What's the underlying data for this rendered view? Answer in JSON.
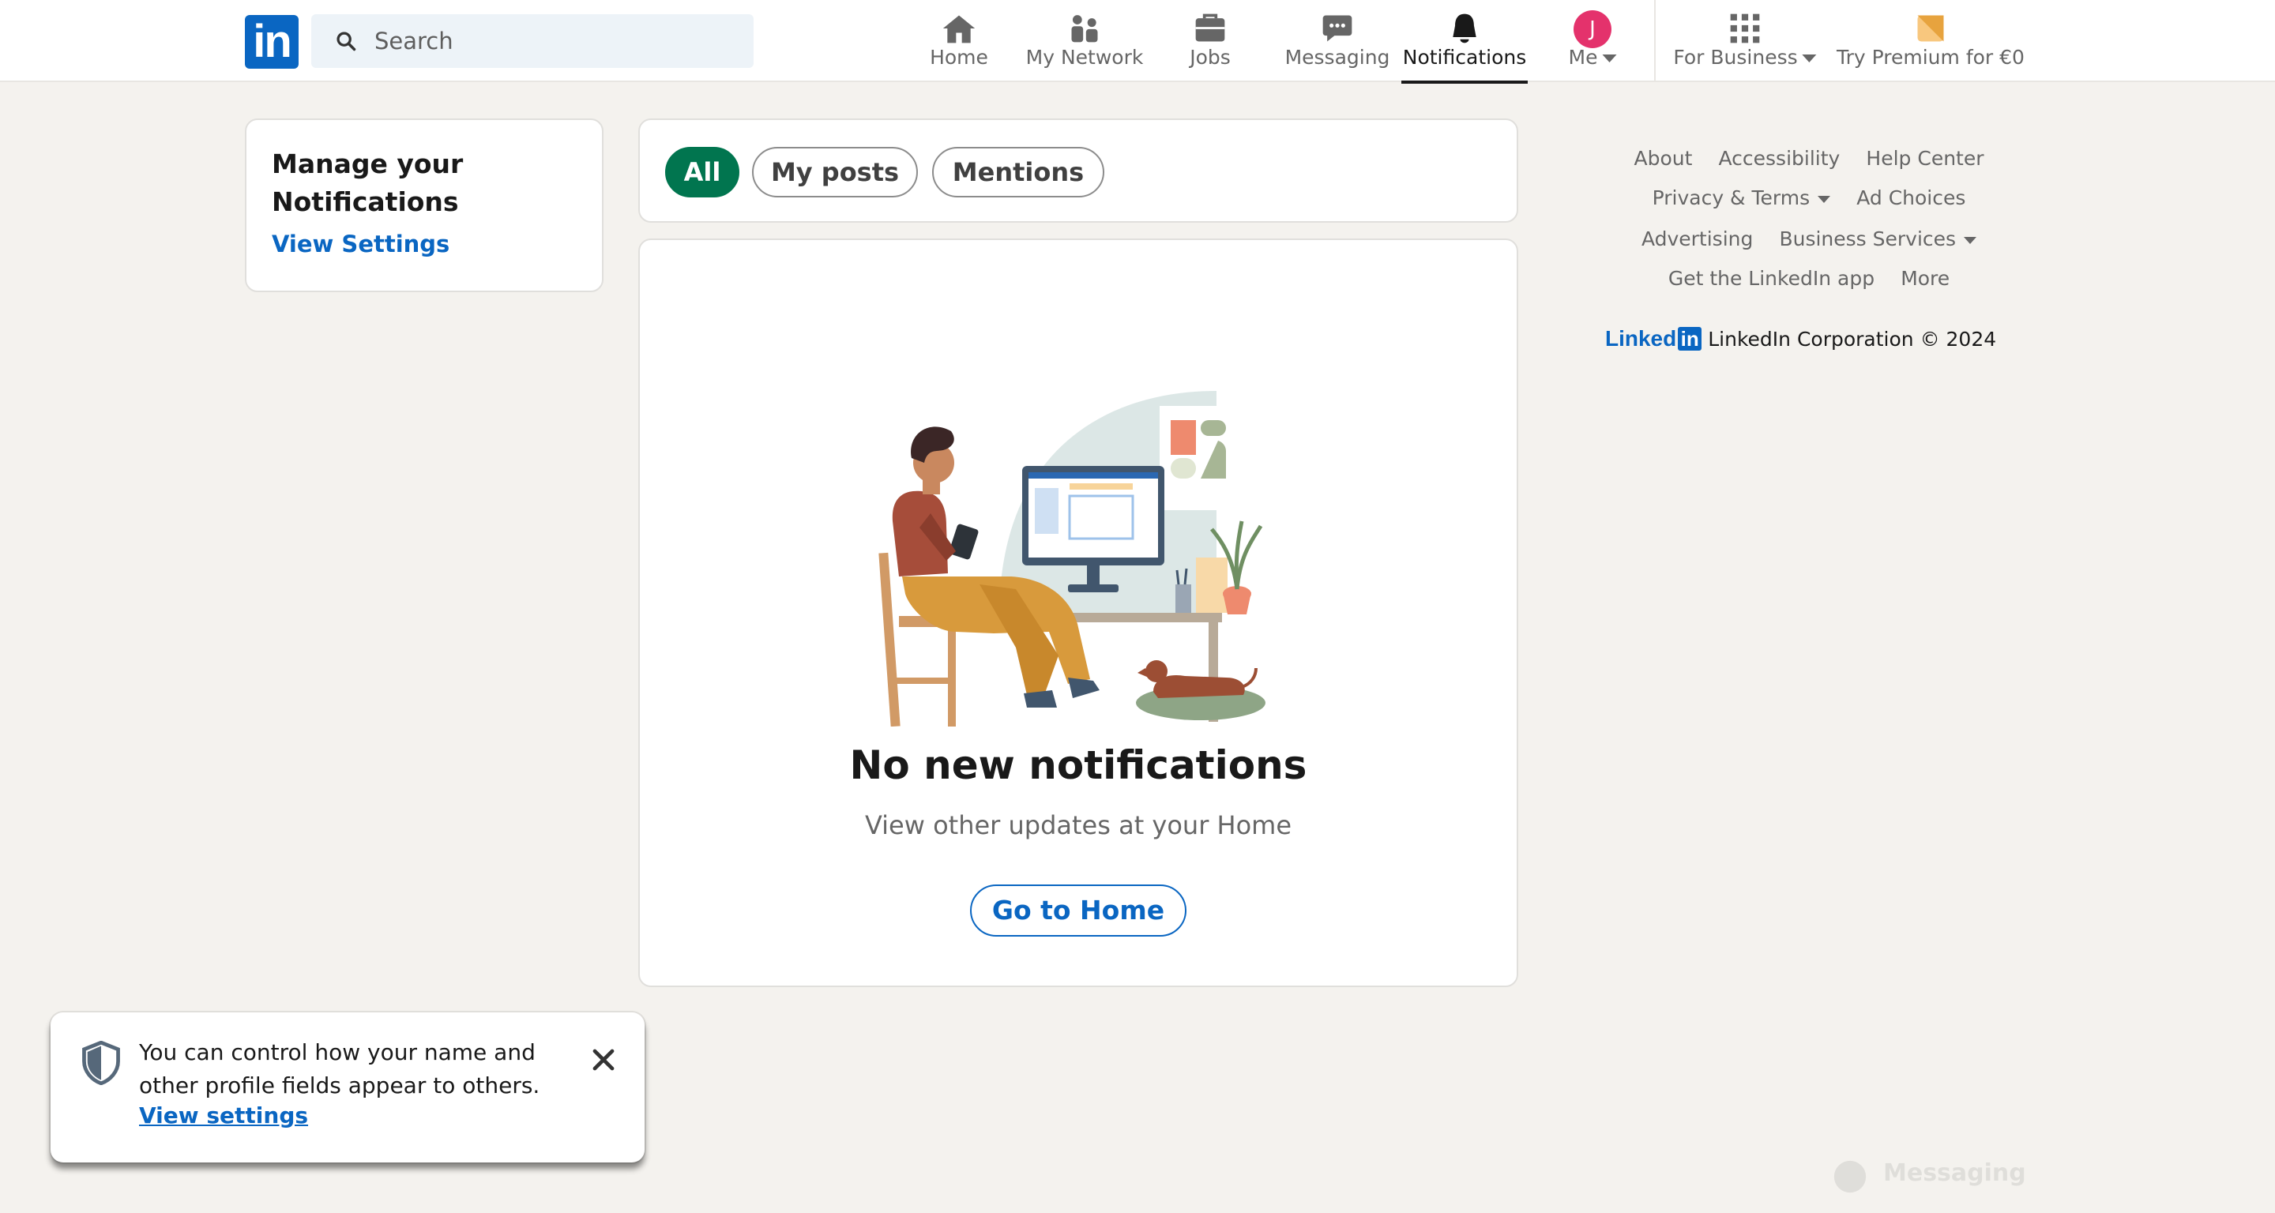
{
  "header": {
    "search_placeholder": "Search",
    "nav": [
      {
        "label": "Home",
        "icon": "home-icon"
      },
      {
        "label": "My Network",
        "icon": "my-network-icon"
      },
      {
        "label": "Jobs",
        "icon": "jobs-icon"
      },
      {
        "label": "Messaging",
        "icon": "messaging-icon"
      },
      {
        "label": "Notifications",
        "icon": "notifications-icon",
        "active": true
      },
      {
        "label": "Me",
        "icon": "avatar",
        "avatar_letter": "J"
      },
      {
        "label": "For Business",
        "icon": "grid-icon"
      },
      {
        "label": "Try Premium for €0",
        "icon": "premium-icon"
      }
    ]
  },
  "left": {
    "title": "Manage your Notifications",
    "settings_link": "View Settings"
  },
  "filters": [
    "All",
    "My posts",
    "Mentions"
  ],
  "main": {
    "empty_title": "No new notifications",
    "empty_subtitle": "View other updates at your Home",
    "go_home": "Go to Home"
  },
  "footer": {
    "links": [
      "About",
      "Accessibility",
      "Help Center",
      "Privacy & Terms",
      "Ad Choices",
      "Advertising",
      "Business Services",
      "Get the LinkedIn app",
      "More"
    ],
    "brand": "Linked",
    "brand_box": "in",
    "copyright": "LinkedIn Corporation © 2024"
  },
  "toast": {
    "message": "You can control how your name and other profile fields appear to others.",
    "link": "View settings"
  },
  "messaging_bar": {
    "label": "Messaging"
  },
  "colors": {
    "brand_blue": "#0a66c2",
    "active_green": "#01754f",
    "page_bg": "#f4f2ee",
    "avatar_pink": "#e4326c"
  }
}
